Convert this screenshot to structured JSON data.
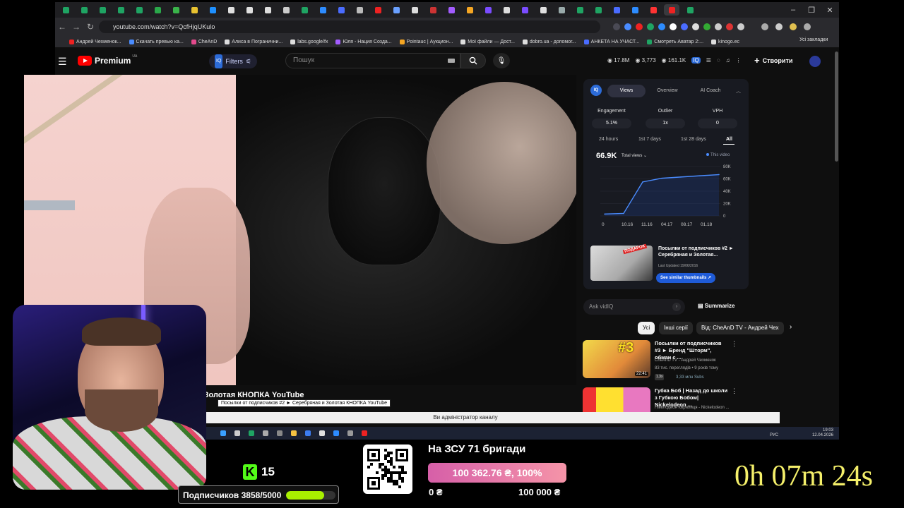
{
  "browser": {
    "url": "youtube.com/watch?v=QcfHjqUKulo",
    "tab_colors": [
      "#1fa463",
      "#1fa463",
      "#1fa463",
      "#1fa463",
      "#1fa463",
      "#2aa84a",
      "#3ab34a",
      "#e8c230",
      "#1e90ff",
      "#e0e0e0",
      "#e0e0e0",
      "#ddd",
      "#ccc",
      "#1fa463",
      "#2d8cff",
      "#4a6cff",
      "#bbb",
      "#e22",
      "#6aa0ff",
      "#ddd",
      "#c33",
      "#a35cff",
      "#f5a623",
      "#7a4cff",
      "#ddd",
      "#7a4cff",
      "#e0e0e0",
      "#9aa",
      "#1fa463",
      "#1fa463",
      "#4a6cff",
      "#2d8cff",
      "#f33",
      "#e22",
      "#1fa463"
    ],
    "bookmarks": [
      {
        "label": "Андрей Чехменок...",
        "color": "#e22"
      },
      {
        "label": "Скачать превью ка...",
        "color": "#4a8cff"
      },
      {
        "label": "CheAnD",
        "color": "#e44a8c"
      },
      {
        "label": "Алиса в Погранични...",
        "color": "#ddd"
      },
      {
        "label": "labs.google/fx",
        "color": "#ddd"
      },
      {
        "label": "Юля - Нация Созда...",
        "color": "#a35cff"
      },
      {
        "label": "Pointauc | Аукцион...",
        "color": "#f5a623"
      },
      {
        "label": "Мої файли — Дост...",
        "color": "#ddd"
      },
      {
        "label": "dobro.ua - допомог...",
        "color": "#ddd"
      },
      {
        "label": "АНКЕТА НА УЧАСТ...",
        "color": "#4a6cff"
      },
      {
        "label": "Смотреть Аватар 2:...",
        "color": "#1fa463"
      },
      {
        "label": "kinogo.ec",
        "color": "#ddd"
      }
    ],
    "bookmarks_all": "Усі закладки"
  },
  "youtube": {
    "logo": "Premium",
    "logo_region": "UA",
    "filters": "Filters",
    "search_placeholder": "Пошук",
    "stats": [
      "17.8M",
      "3,773",
      "161.1K"
    ],
    "create": "Створити",
    "video_title": "Серебряная и Золотая КНОПКА YouTube",
    "tooltip": "Посылки от подписчиков #2 ► Серебряная и Золотая КНОПКА YouTube",
    "admin_notice": "Ви адміністратор каналу"
  },
  "vidiq": {
    "logo": "IQ",
    "tabs": [
      "Views",
      "Overview",
      "AI Coach"
    ],
    "metrics": [
      {
        "label": "Engagement",
        "value": "5.1%"
      },
      {
        "label": "Outlier",
        "value": "1x"
      },
      {
        "label": "VPH",
        "value": "0"
      }
    ],
    "periods": [
      "24 hours",
      "1st 7 days",
      "1st 28 days",
      "All"
    ],
    "big_views": "66.9K",
    "total_views": "Total views",
    "this_video": "This video",
    "thumb_title": "Посылки от подписчиков #2 ► Серебряная и Золотая...",
    "thumb_updated": "Last Updated 19/06/2016",
    "similar_btn": "See similar thumbnails",
    "ask_placeholder": "Ask vidIQ",
    "summarize": "Summarize"
  },
  "chips": [
    "Усі",
    "Інші серії",
    "Від: CheAnD TV - Андрей Чех"
  ],
  "recommendations": [
    {
      "title": "Посылки от подписчиков #3 ► Бренд \"Шторм\", обман с ...",
      "channel": "CheAnD TV - Андрей Чехменок",
      "meta": "83 тис. переглядів • 9 років тому",
      "duration": "22:41",
      "badge": "1.3x",
      "subs": "3,33 млн Subs"
    },
    {
      "title": "Губка Боб | Назад до школи з Губкою Бобом| Nickelodeon ...",
      "channel": "Нікелодеон Кирилиця - Nickelodeon ...",
      "meta": "",
      "duration": "",
      "badge": "",
      "subs": ""
    }
  ],
  "taskbar": {
    "lang": "РУС",
    "time": "19:03",
    "date": "12.04.2026"
  },
  "chart_data": {
    "type": "line",
    "x": [
      "10.16",
      "11.16",
      "04.17",
      "08.17",
      "01.18"
    ],
    "x_extra": "0",
    "y_ticks": [
      "80K",
      "60K",
      "40K",
      "20K",
      "0"
    ],
    "ylim": [
      0,
      80000
    ],
    "series": [
      {
        "values": [
          3000,
          4000,
          55000,
          61000,
          63000,
          65000,
          66900
        ]
      }
    ]
  },
  "overlay": {
    "kick_count": "15",
    "subs_label": "Подписчиков 3858/5000",
    "subs_progress": 0.77,
    "donation_title": "На ЗСУ 71 бригади",
    "donation_value": "100 362.76 ₴, 100%",
    "donation_progress": 1.0,
    "donation_min": "0 ₴",
    "donation_max": "100 000 ₴",
    "timer": "0h 07m 24s"
  }
}
